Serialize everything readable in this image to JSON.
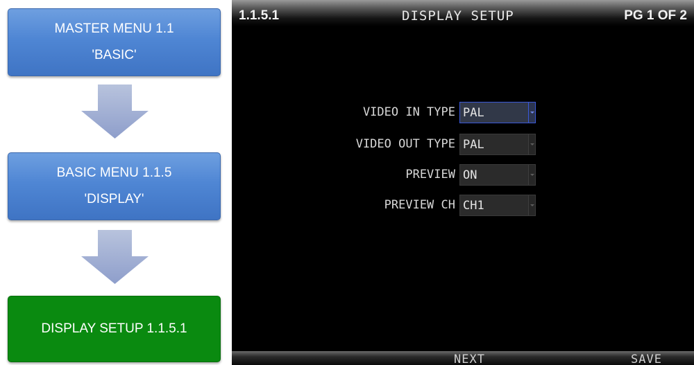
{
  "flowchart": {
    "steps": [
      {
        "line1": "MASTER MENU 1.1",
        "line2": "'BASIC'"
      },
      {
        "line1": "BASIC MENU 1.1.5",
        "line2": "'DISPLAY'"
      },
      {
        "line1": "DISPLAY SETUP 1.1.5.1"
      }
    ],
    "colors": {
      "blue": "#4f86d4",
      "green": "#0a8a10",
      "arrow": "#9eaed6"
    }
  },
  "screen": {
    "menu_code": "1.1.5.1",
    "title": "DISPLAY SETUP",
    "page": "PG 1 OF 2",
    "fields": [
      {
        "label": "VIDEO IN TYPE",
        "value": "PAL",
        "focused": true
      },
      {
        "label": "VIDEO OUT TYPE",
        "value": "PAL",
        "focused": false
      },
      {
        "label": "PREVIEW",
        "value": "ON",
        "focused": false
      },
      {
        "label": "PREVIEW CH",
        "value": "CH1",
        "focused": false
      }
    ],
    "buttons": {
      "next": "NEXT",
      "save": "SAVE"
    },
    "colors": {
      "background": "#000000",
      "focus": "#3a58d8"
    }
  }
}
